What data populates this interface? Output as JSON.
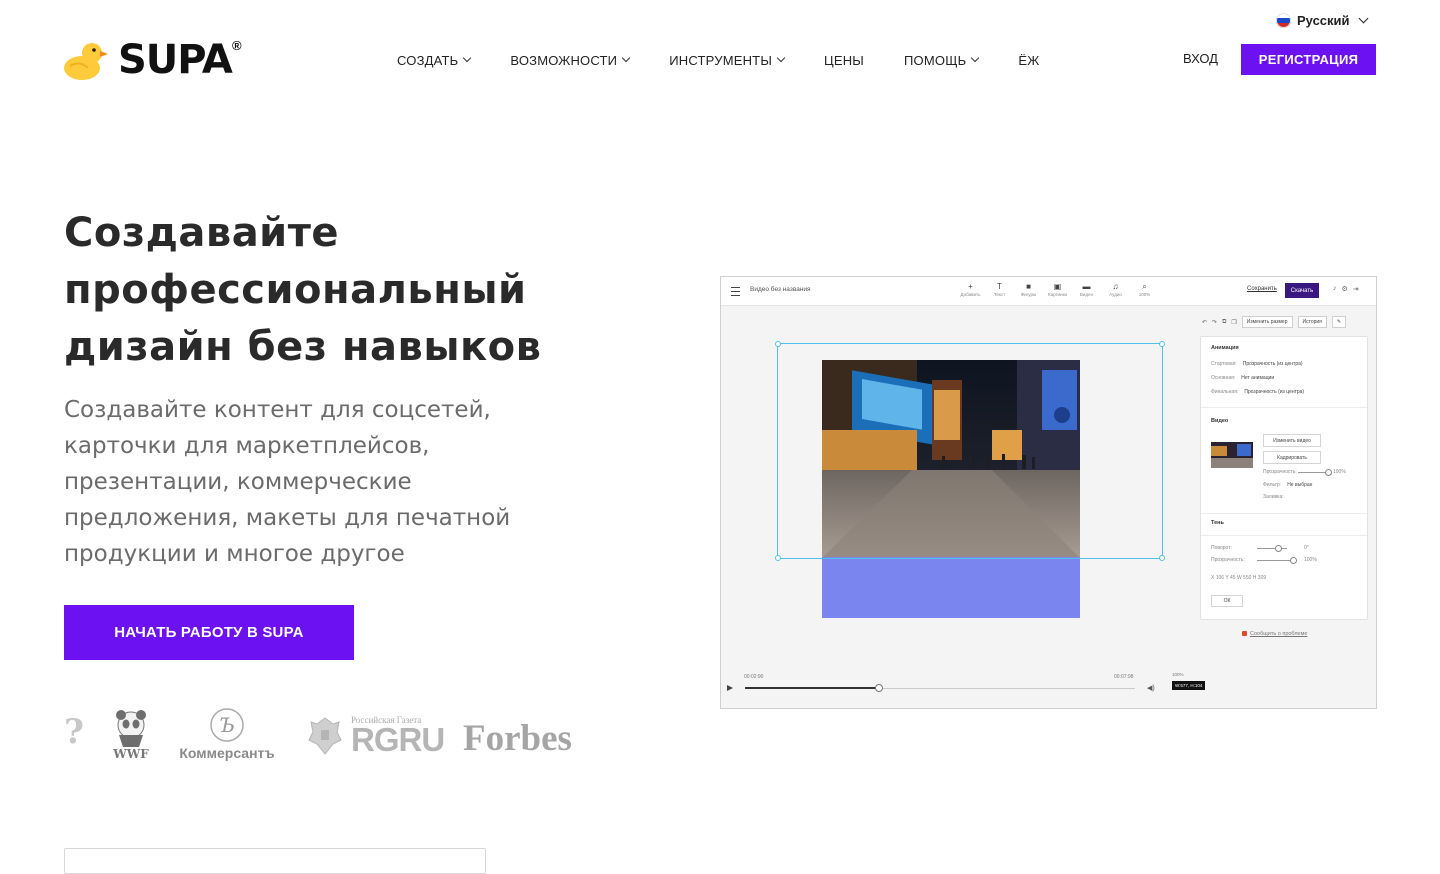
{
  "header": {
    "language": "Русский",
    "logo_text": "SUPA",
    "logo_reg": "®",
    "nav": [
      {
        "label": "СОЗДАТЬ",
        "dropdown": true
      },
      {
        "label": "ВОЗМОЖНОСТИ",
        "dropdown": true
      },
      {
        "label": "ИНСТРУМЕНТЫ",
        "dropdown": true
      },
      {
        "label": "ЦЕНЫ",
        "dropdown": false
      },
      {
        "label": "ПОМОЩЬ",
        "dropdown": true
      },
      {
        "label": "ЁЖ",
        "dropdown": false
      }
    ],
    "login": "ВХОД",
    "register": "РЕГИСТРАЦИЯ"
  },
  "hero": {
    "title": "Создавайте профессиональный дизайн без навыков",
    "subtitle": "Создавайте контент для соцсетей, карточки для маркетплейсов, презентации, коммерческие предложения, макеты для печатной продукции и многое другое",
    "cta": "НАЧАТЬ РАБОТУ В SUPA"
  },
  "press": {
    "partial": "?",
    "wwf": "WWF",
    "kommersant": "Коммерсантъ",
    "rg_small": "Российская Газета",
    "rg_big": "RGRU",
    "forbes": "Forbes"
  },
  "editor": {
    "doc_title": "Видео без названия",
    "tools": [
      {
        "icon": "+",
        "label": "Добавить"
      },
      {
        "icon": "T",
        "label": "Текст"
      },
      {
        "icon": "■",
        "label": "Фигуры"
      },
      {
        "icon": "▣",
        "label": "Картинки"
      },
      {
        "icon": "▬",
        "label": "Видео"
      },
      {
        "icon": "♫",
        "label": "Аудио"
      },
      {
        "icon": "⌕",
        "label": "100%"
      }
    ],
    "save": "Сохранить",
    "download": "Скачать",
    "resize": "Изменить размер",
    "history": "История",
    "animation_title": "Анимация",
    "anim_rows": [
      {
        "label": "Стартовая:",
        "value": "Прозрачность (из центра)"
      },
      {
        "label": "Основная:",
        "value": "Нет анимации"
      },
      {
        "label": "Финальная:",
        "value": "Прозрачность (из центра)"
      }
    ],
    "video_title": "Видео",
    "change_video": "Изменить видео",
    "crop": "Кадрировать",
    "opacity_label": "Прозрачность:",
    "opacity_value": "100%",
    "filter_label": "Фильтр:",
    "filter_value": "Не выбран",
    "fill_label": "Заливка:",
    "shadow_title": "Тень",
    "rotate_label": "Поворот:",
    "rotate_value": "0°",
    "opacity2_label": "Прозрачность:",
    "opacity2_value": "100%",
    "coords": "X 106   Y 45   W 550   H 309",
    "ok": "ОК",
    "report": "Сообщить о проблеме",
    "time_start": "00:02:90",
    "time_end": "00:07:98",
    "zoom_pct": "100%",
    "zoom_badge": "W:577, H:104",
    "progress": 0.34
  }
}
